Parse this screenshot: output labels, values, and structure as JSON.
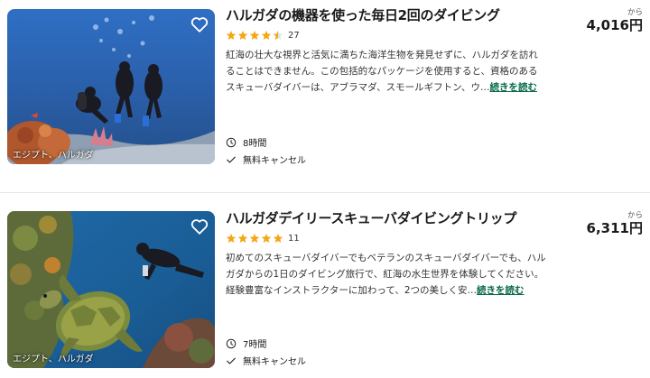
{
  "listings": [
    {
      "title": "ハルガダの機器を使った毎日2回のダイビング",
      "rating": 4.5,
      "review_count": "27",
      "description": "紅海の壮大な視界と活気に満ちた海洋生物を発見せずに、ハルガダを訪れることはできません。この包括的なパッケージを使用すると、資格のあるスキューバダイバーは、アブラマダ、スモールギフトン、ウ…",
      "read_more": "続きを読む",
      "location": "エジプト、ハルガダ",
      "duration": "8時間",
      "cancellation": "無料キャンセル",
      "price_from": "から",
      "price": "4,016円",
      "image_icon": "heart-icon"
    },
    {
      "title": "ハルガダデイリースキューバダイビングトリップ",
      "rating": 5,
      "review_count": "11",
      "description": "初めてのスキューバダイバーでもベテランのスキューバダイバーでも、ハルガダからの1日のダイビング旅行で、紅海の水生世界を体験してください。経験豊富なインストラクターに加わって、2つの美しく安…",
      "read_more": "続きを読む",
      "location": "エジプト、ハルガダ",
      "duration": "7時間",
      "cancellation": "無料キャンセル",
      "price_from": "から",
      "price": "6,311円",
      "image_icon": "heart-icon"
    }
  ],
  "colors": {
    "star": "#f3a712",
    "link": "#0a6b4a",
    "separator": "#e6e6e6"
  },
  "icons": [
    "heart-icon",
    "star-icon",
    "clock-icon",
    "check-icon"
  ]
}
